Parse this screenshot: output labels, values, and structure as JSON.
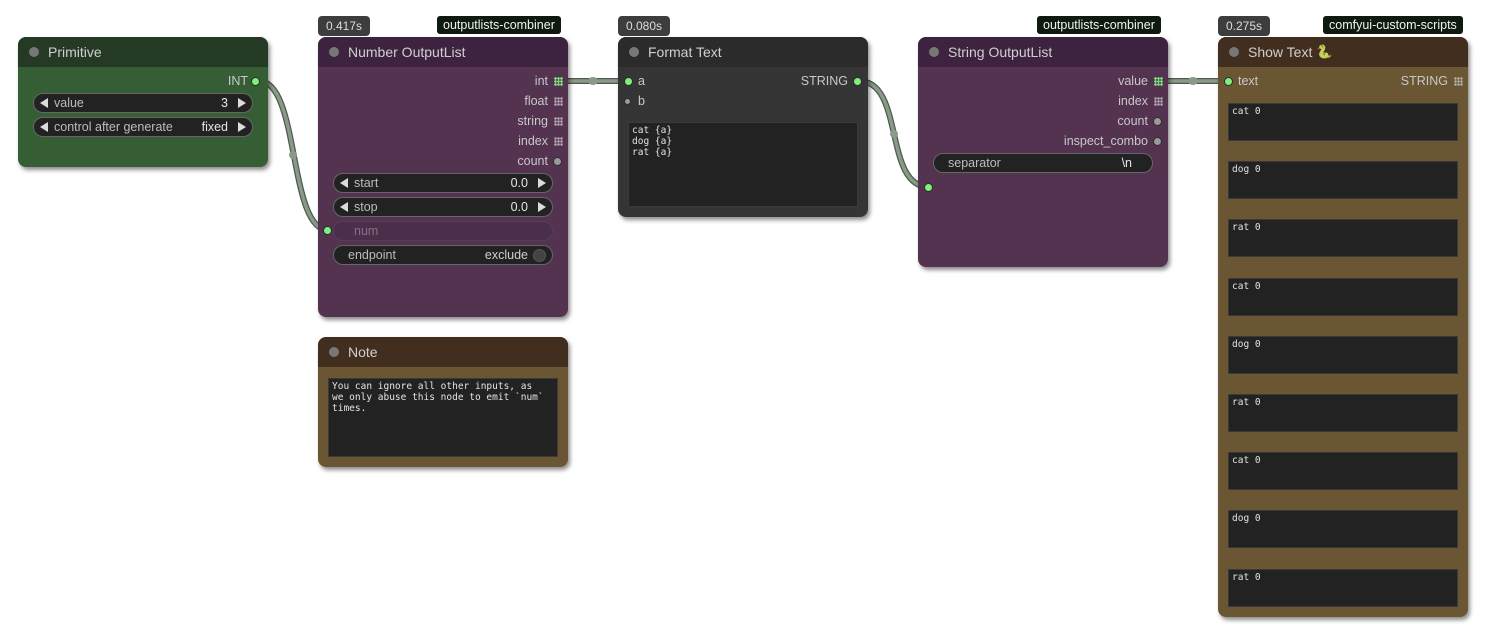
{
  "colors": {
    "primitive_header": "#243a24",
    "primitive_body": "#355e35",
    "purple_header": "#3e2340",
    "purple_body": "#533350",
    "dark_header": "#2b2b2b",
    "dark_body": "#353535",
    "brown_header": "#422e1e",
    "brown_body": "#6b5634",
    "wire": "#8a9a88",
    "slot_connected": "#7df07d"
  },
  "primitive": {
    "title": "Primitive",
    "output_label": "INT",
    "value_label": "value",
    "value": "3",
    "control_label": "control after generate",
    "control_value": "fixed"
  },
  "number_outputlist": {
    "time_badge": "0.417s",
    "source_badge": "outputlists-combiner",
    "title": "Number OutputList",
    "outputs": [
      "int",
      "float",
      "string",
      "index",
      "count"
    ],
    "start_label": "start",
    "start_value": "0.0",
    "stop_label": "stop",
    "stop_value": "0.0",
    "num_placeholder": "num",
    "endpoint_label": "endpoint",
    "endpoint_value": "exclude"
  },
  "note": {
    "title": "Note",
    "text": "You can ignore all other inputs, as\nwe only abuse this node to emit `num`\ntimes."
  },
  "format_text": {
    "time_badge": "0.080s",
    "title": "Format Text",
    "input_a": "a",
    "input_b": "b",
    "output_label": "STRING",
    "template": "cat {a}\ndog {a}\nrat {a}"
  },
  "string_outputlist": {
    "source_badge": "outputlists-combiner",
    "title": "String OutputList",
    "outputs": [
      "value",
      "index",
      "count",
      "inspect_combo"
    ],
    "separator_label": "separator",
    "separator_value": "\\n"
  },
  "show_text": {
    "time_badge": "0.275s",
    "source_badge": "comfyui-custom-scripts",
    "title": "Show Text",
    "title_icon": "snake-icon",
    "input_label": "text",
    "output_label": "STRING",
    "entries": [
      "cat 0",
      "dog 0",
      "rat 0",
      "cat 0",
      "dog 0",
      "rat 0",
      "cat 0",
      "dog 0",
      "rat 0"
    ]
  }
}
